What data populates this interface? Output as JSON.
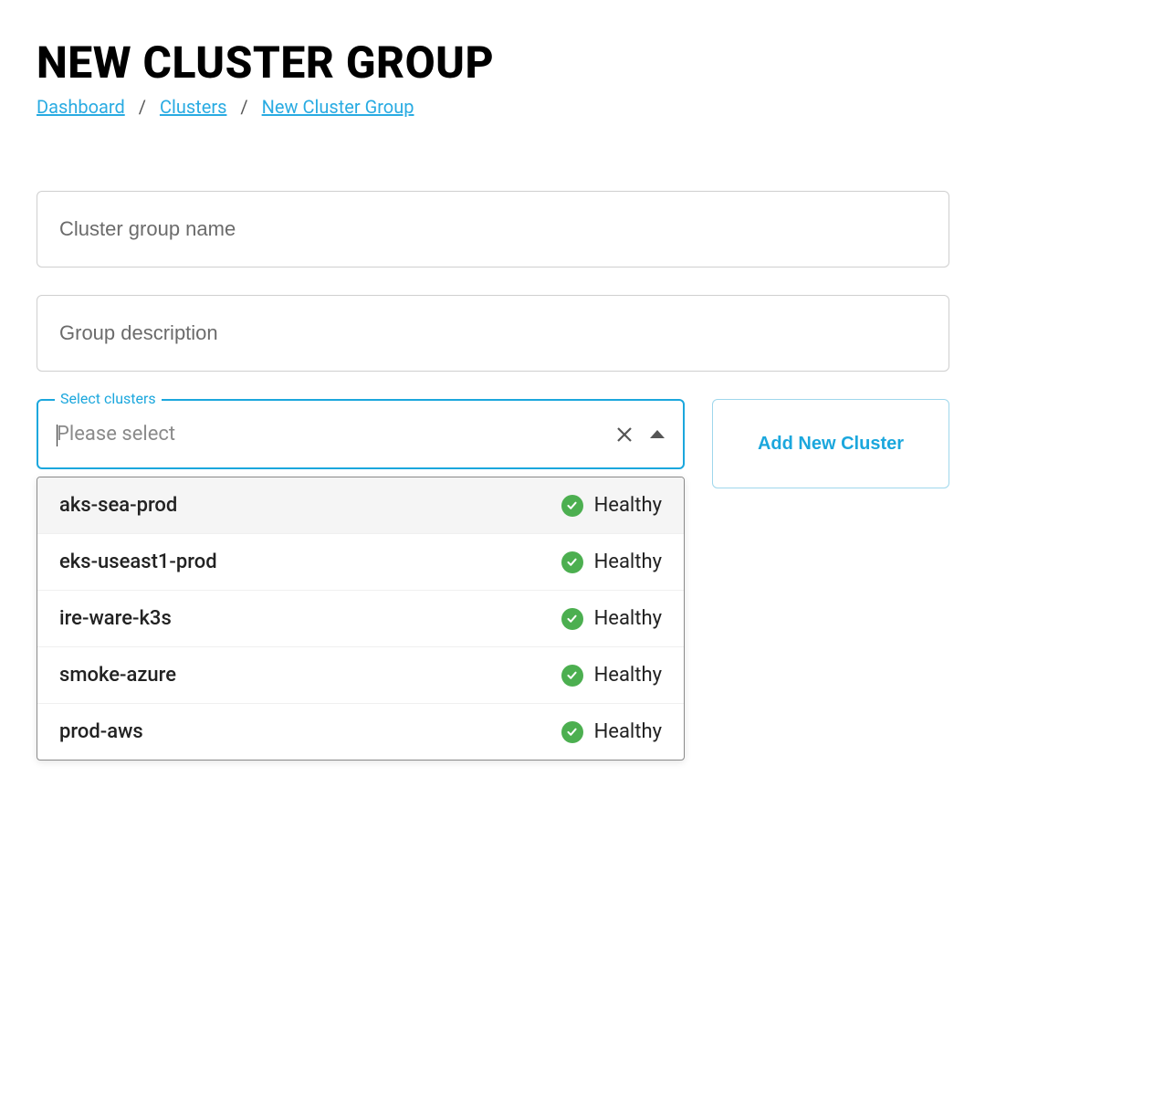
{
  "header": {
    "title": "NEW CLUSTER GROUP"
  },
  "breadcrumb": {
    "items": [
      {
        "label": "Dashboard"
      },
      {
        "label": "Clusters"
      },
      {
        "label": "New Cluster Group"
      }
    ],
    "separator": "/"
  },
  "form": {
    "name_placeholder": "Cluster group name",
    "name_value": "",
    "description_placeholder": "Group description",
    "description_value": "",
    "select": {
      "label": "Select clusters",
      "placeholder": "Please select",
      "options": [
        {
          "name": "aks-sea-prod",
          "status": "Healthy",
          "highlight": true
        },
        {
          "name": "eks-useast1-prod",
          "status": "Healthy",
          "highlight": false
        },
        {
          "name": "ire-ware-k3s",
          "status": "Healthy",
          "highlight": false
        },
        {
          "name": "smoke-azure",
          "status": "Healthy",
          "highlight": false
        },
        {
          "name": "prod-aws",
          "status": "Healthy",
          "highlight": false
        }
      ]
    },
    "add_cluster_label": "Add New Cluster"
  }
}
